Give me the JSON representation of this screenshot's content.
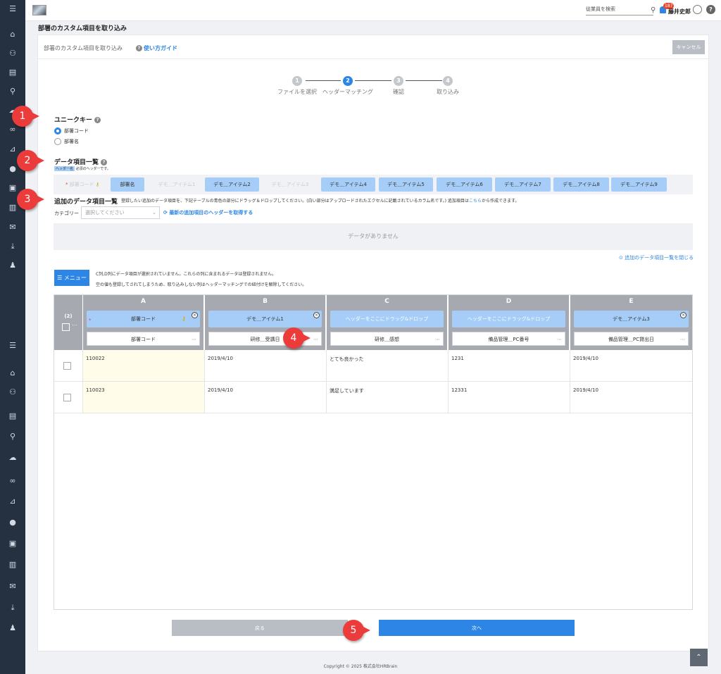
{
  "topbar": {
    "search_placeholder": "従業員を検索",
    "notification_count": "187",
    "user_name": "藤井史郎",
    "help_label": "?"
  },
  "page_title": "部署のカスタム項目を取り込み",
  "panel": {
    "title": "部署のカスタム項目を取り込み",
    "guide_label": "使い方ガイド",
    "cancel_label": "キャンセル"
  },
  "steps": [
    {
      "num": "1",
      "label": "ファイルを選択"
    },
    {
      "num": "2",
      "label": "ヘッダーマッチング"
    },
    {
      "num": "3",
      "label": "確認"
    },
    {
      "num": "4",
      "label": "取り込み"
    }
  ],
  "active_step": 2,
  "unique_key": {
    "title": "ユニークキー",
    "options": [
      "部署コード",
      "部署名"
    ],
    "selected": "部署コード"
  },
  "data_items": {
    "title": "データ項目一覧",
    "legend_tag": "ヘッダー名",
    "legend_text": "必須のヘッダーです。",
    "chips": [
      {
        "label": "部署コード",
        "state": "ghost"
      },
      {
        "label": "部署名",
        "state": "blue"
      },
      {
        "label": "デモ＿アイテム1",
        "state": "ghost"
      },
      {
        "label": "デモ＿アイテム2",
        "state": "blue"
      },
      {
        "label": "デモ＿アイテム3",
        "state": "ghost"
      },
      {
        "label": "デモ＿アイテム4",
        "state": "blue"
      },
      {
        "label": "デモ＿アイテム5",
        "state": "blue"
      },
      {
        "label": "デモ＿アイテム6",
        "state": "blue"
      },
      {
        "label": "デモ＿アイテム7",
        "state": "blue"
      },
      {
        "label": "デモ＿アイテム8",
        "state": "blue"
      },
      {
        "label": "デモ＿アイテム9",
        "state": "blue"
      }
    ]
  },
  "additional": {
    "title": "追加のデータ項目一覧",
    "desc_a": "登録したい追加のデータ項目を、下記テーブルの青色の部分にドラッグ＆ドロップしてください。(白い部分はアップロードされたエクセルに記載されているカラム名です。) 追加項目は",
    "desc_link": "こちら",
    "desc_b": "から作成できます。",
    "category_label": "カテゴリー",
    "category_placeholder": "選択してください",
    "refresh_label": "最新の追加項目のヘッダーを取得する",
    "empty_text": "データがありません",
    "close_link": "追加のデータ項目一覧を閉じる"
  },
  "menu": {
    "label": "メニュー",
    "warning1": "C列,D列にデータ項目が選択されていません。これらの列に含まれるデータは登録されません。",
    "warning2": "空の値も登録してされてしまうため、取り込みしない列はヘッダーマッチングでの紐付けを解除してください。"
  },
  "table": {
    "row_count_label": "(2)",
    "columns": [
      {
        "letter": "A",
        "header": "部署コード",
        "required": true,
        "key": true,
        "excel": "部署コード"
      },
      {
        "letter": "B",
        "header": "デモ＿アイテム1",
        "excel": "研修＿受講日"
      },
      {
        "letter": "C",
        "header": "ヘッダーをここにドラッグ&ドロップ",
        "empty": true,
        "excel": "研修＿感想"
      },
      {
        "letter": "D",
        "header": "ヘッダーをここにドラッグ&ドロップ",
        "empty": true,
        "excel": "備品管理＿PC番号"
      },
      {
        "letter": "E",
        "header": "デモ＿アイテム3",
        "excel": "備品管理＿PC貸出日"
      }
    ],
    "rows": [
      [
        "110022",
        "2019/4/10",
        "とても良かった",
        "1231",
        "2019/4/10"
      ],
      [
        "110023",
        "2019/4/10",
        "満足しています",
        "12331",
        "2019/4/10"
      ]
    ]
  },
  "buttons": {
    "back": "戻る",
    "next": "次へ"
  },
  "markers": [
    "1",
    "2",
    "3",
    "4",
    "5"
  ],
  "copyright": "Copyright © 2025 株式会社HRBrain",
  "colors": {
    "accent": "#2d86e5",
    "sidebar": "#253041",
    "chip": "#a6cdf7",
    "marker": "#ec3b3b"
  }
}
